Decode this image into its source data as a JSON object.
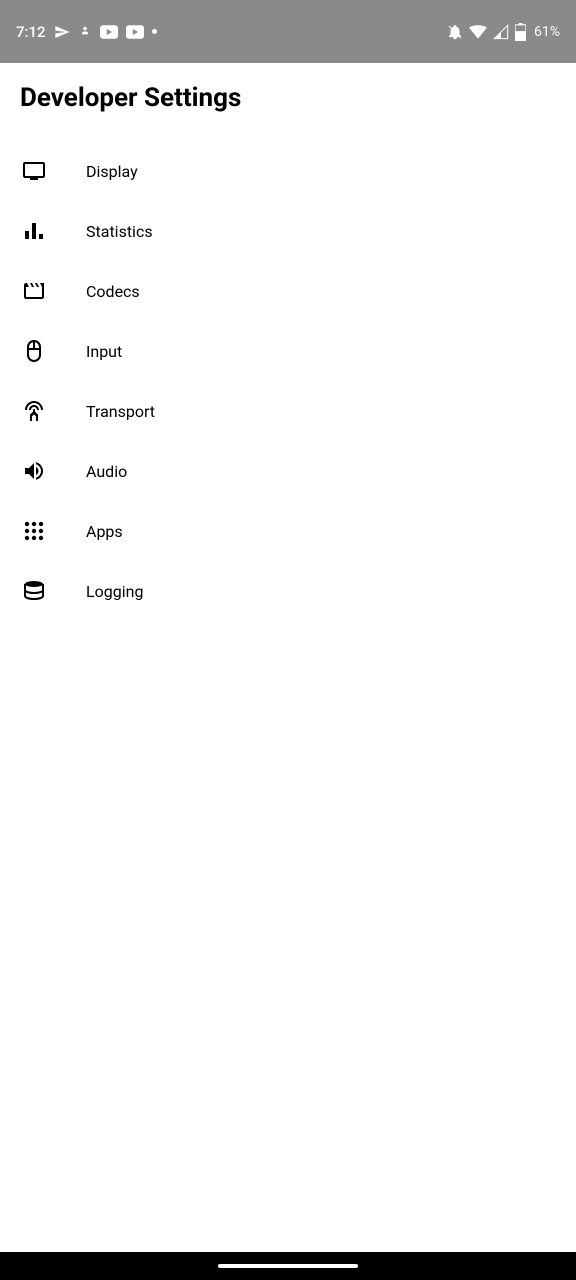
{
  "status_bar": {
    "time": "7:12",
    "battery": "61%"
  },
  "page": {
    "title": "Developer Settings"
  },
  "menu": {
    "items": [
      {
        "label": "Display",
        "icon": "display-icon"
      },
      {
        "label": "Statistics",
        "icon": "statistics-icon"
      },
      {
        "label": "Codecs",
        "icon": "codecs-icon"
      },
      {
        "label": "Input",
        "icon": "input-icon"
      },
      {
        "label": "Transport",
        "icon": "transport-icon"
      },
      {
        "label": "Audio",
        "icon": "audio-icon"
      },
      {
        "label": "Apps",
        "icon": "apps-icon"
      },
      {
        "label": "Logging",
        "icon": "logging-icon"
      }
    ]
  }
}
